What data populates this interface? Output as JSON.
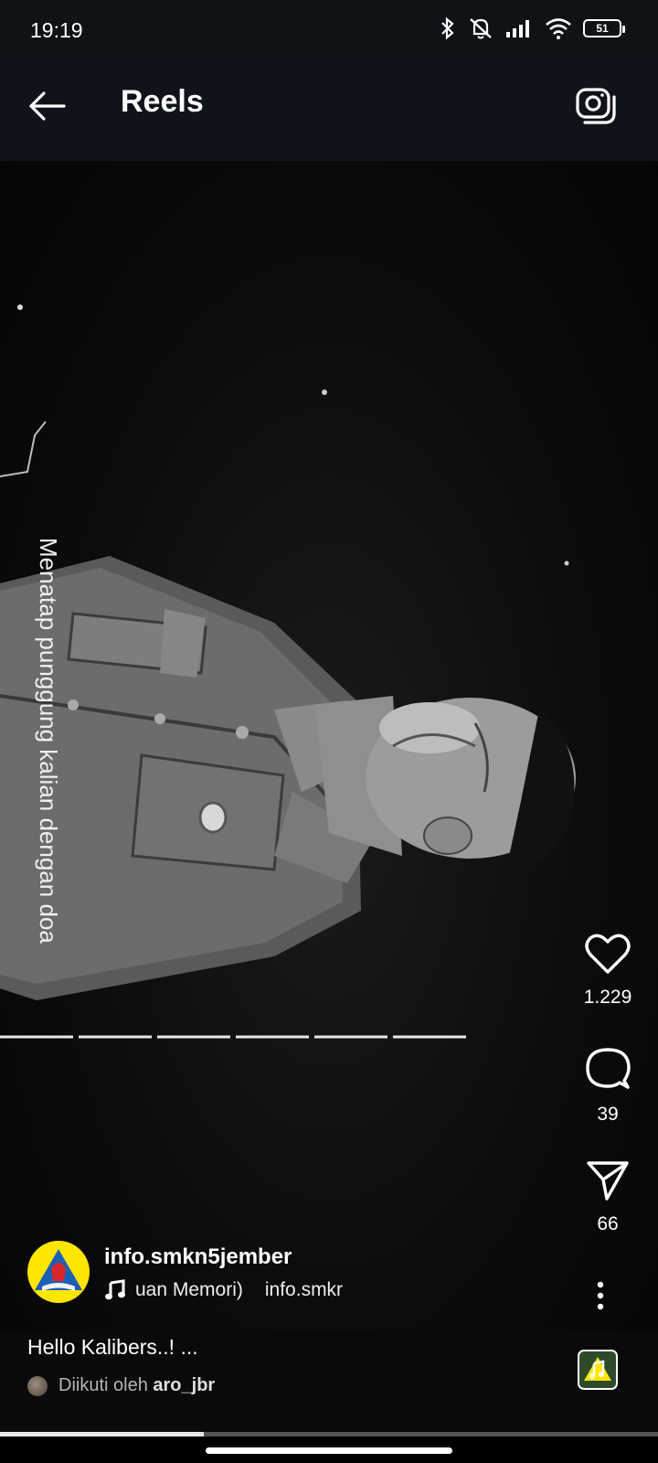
{
  "status_bar": {
    "time": "19:19",
    "battery": "51"
  },
  "header": {
    "title": "Reels"
  },
  "video": {
    "overlay_text": "Menatap punggung kalian dengan doa"
  },
  "actions": {
    "likes": "1.229",
    "comments": "39",
    "shares": "66"
  },
  "author": {
    "username": "info.smkn5jember",
    "music_title": "uan Memori)",
    "music_artist": "info.smkr"
  },
  "caption": {
    "text": "Hello Kalibers..! ...",
    "followed_prefix": "Diikuti oleh",
    "followed_user": "aro_jbr"
  },
  "playback": {
    "progress": 0.31
  },
  "colors": {
    "background": "#000000",
    "topbar": "#10141a",
    "avatar_yellow": "#ffe600"
  },
  "icons": [
    "back-arrow-icon",
    "camera-icon",
    "heart-icon",
    "comment-icon",
    "send-icon",
    "more-icon",
    "music-note-icon"
  ]
}
